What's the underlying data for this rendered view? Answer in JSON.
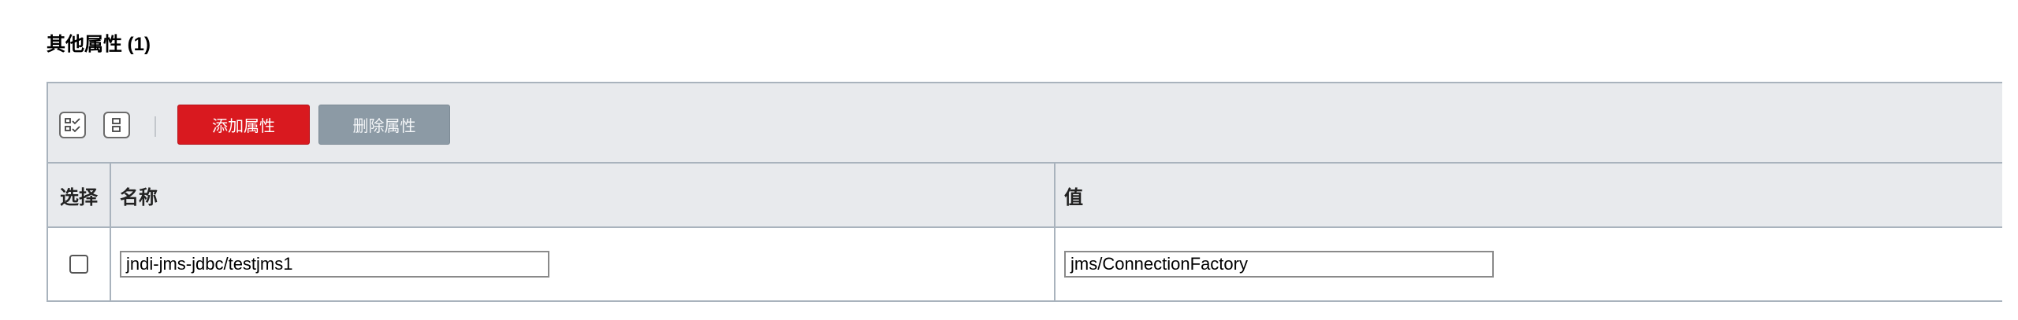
{
  "section": {
    "title": "其他属性 (1)"
  },
  "toolbar": {
    "select_all_icon": "select-all-icon",
    "deselect_icon": "deselect-all-icon",
    "add_label": "添加属性",
    "delete_label": "删除属性",
    "add_color": "#d9191f",
    "delete_color": "#8c9aa5"
  },
  "table": {
    "columns": [
      "选择",
      "名称",
      "值"
    ],
    "rows": [
      {
        "selected": false,
        "name": "jndi-jms-jdbc/testjms1",
        "value": "jms/ConnectionFactory"
      }
    ]
  }
}
